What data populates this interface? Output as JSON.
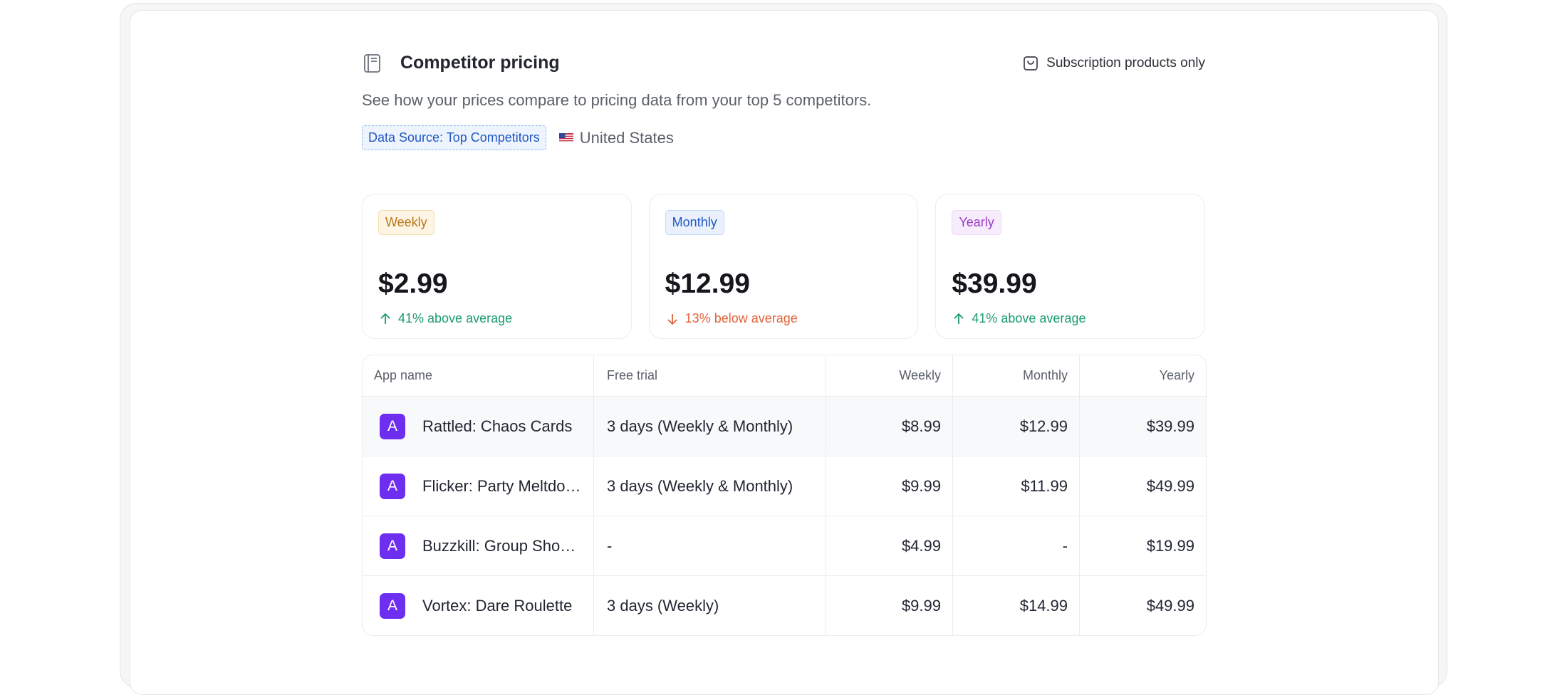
{
  "header": {
    "title": "Competitor pricing",
    "icon": "book-icon",
    "subscription_toggle": {
      "label": "Subscription products only",
      "icon": "checkbox-icon",
      "checked": false
    }
  },
  "description": "See how your prices compare to pricing data from your top 5 competitors.",
  "filters": {
    "data_source": "Data Source: Top Competitors",
    "country": "United States",
    "country_icon": "us-flag-icon"
  },
  "summary_cards": [
    {
      "period": "Weekly",
      "price": "$2.99",
      "delta": "41% above average",
      "direction": "up",
      "badge_color": "#b9781a",
      "badge_bg": "#fdf4e3",
      "delta_color": "#1a9c6b"
    },
    {
      "period": "Monthly",
      "price": "$12.99",
      "delta": "13% below average",
      "direction": "down",
      "badge_color": "#1f57c4",
      "badge_bg": "#eaf1fd",
      "delta_color": "#e0623a"
    },
    {
      "period": "Yearly",
      "price": "$39.99",
      "delta": "41% above average",
      "direction": "up",
      "badge_color": "#9b3bc4",
      "badge_bg": "#f7ecfc",
      "delta_color": "#1a9c6b"
    }
  ],
  "table": {
    "columns": [
      "App name",
      "Free trial",
      "Weekly",
      "Monthly",
      "Yearly"
    ],
    "rows": [
      {
        "icon_letter": "A",
        "app_name": "Rattled: Chaos Cards",
        "free_trial": "3 days (Weekly & Monthly)",
        "weekly": "$8.99",
        "monthly": "$12.99",
        "yearly": "$39.99"
      },
      {
        "icon_letter": "A",
        "app_name": "Flicker: Party Meltdo…",
        "free_trial": "3 days (Weekly & Monthly)",
        "weekly": "$9.99",
        "monthly": "$11.99",
        "yearly": "$49.99"
      },
      {
        "icon_letter": "A",
        "app_name": "Buzzkill: Group Show…",
        "free_trial": "-",
        "weekly": "$4.99",
        "monthly": "-",
        "yearly": "$19.99"
      },
      {
        "icon_letter": "A",
        "app_name": "Vortex: Dare Roulette",
        "free_trial": "3 days (Weekly)",
        "weekly": "$9.99",
        "monthly": "$14.99",
        "yearly": "$49.99"
      }
    ]
  },
  "colors": {
    "app_icon": "#6d2ef0",
    "accent_blue": "#1f57c4"
  }
}
